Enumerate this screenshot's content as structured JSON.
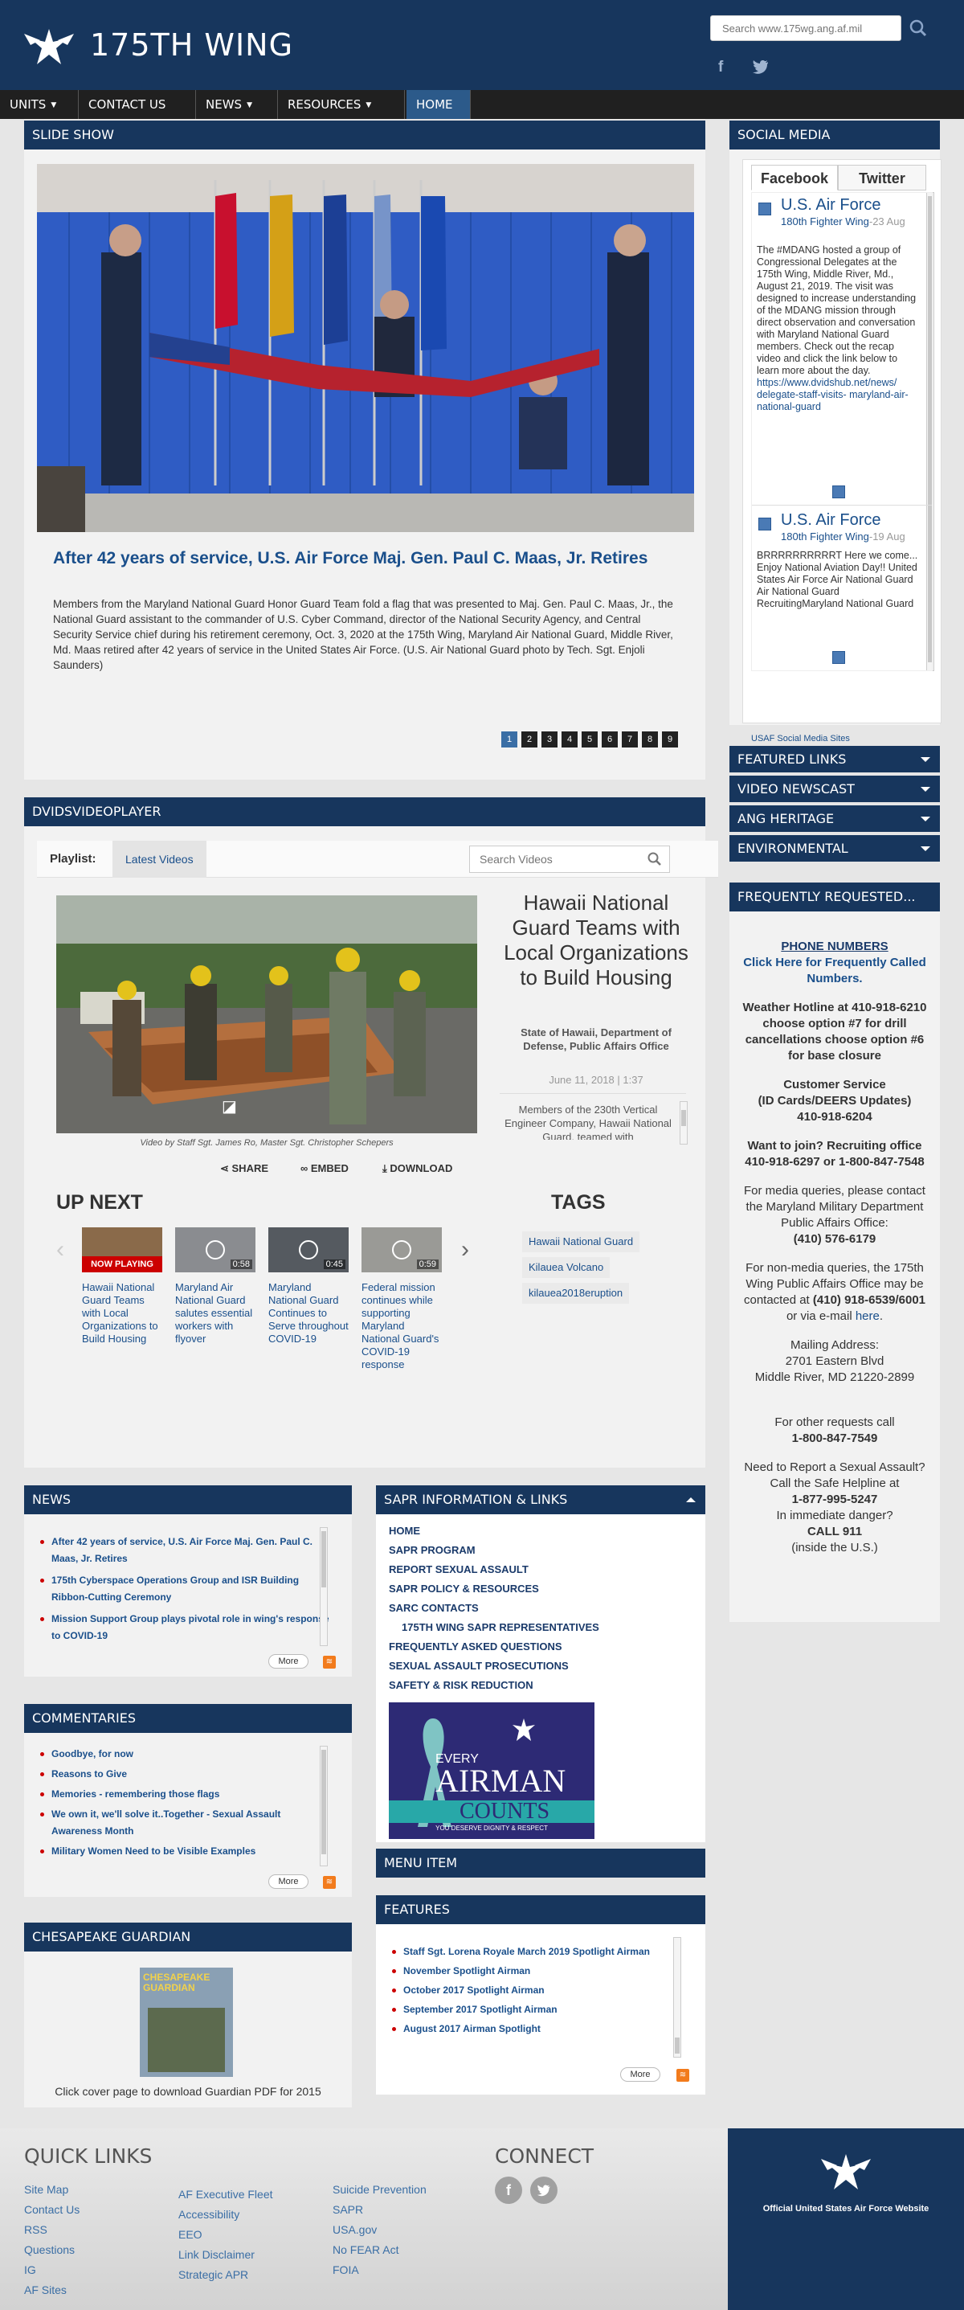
{
  "header": {
    "site_title": "175TH WING",
    "search_placeholder": "Search www.175wg.ang.af.mil",
    "facebook_glyph": "f"
  },
  "nav": {
    "items": [
      {
        "label": "UNITS"
      },
      {
        "label": "CONTACT US"
      },
      {
        "label": "NEWS"
      },
      {
        "label": "RESOURCES"
      },
      {
        "label": "HOME"
      }
    ]
  },
  "slideshow": {
    "heading": "SLIDE SHOW",
    "title": "After 42 years of service, U.S. Air Force Maj. Gen. Paul C. Maas, Jr. Retires",
    "caption": "Members from the Maryland National Guard Honor Guard Team fold a flag that was presented to Maj. Gen. Paul C. Maas, Jr., the National Guard assistant to the commander of U.S. Cyber Command, director of the National Security Agency, and Central Security Service chief during his retirement ceremony, Oct. 3, 2020 at the 175th Wing, Maryland Air National Guard, Middle River, Md. Maas retired after 42 years of service in the United States Air Force. (U.S. Air National Guard photo by Tech. Sgt. Enjoli Saunders)",
    "pages": [
      "1",
      "2",
      "3",
      "4",
      "5",
      "6",
      "7",
      "8",
      "9"
    ],
    "active_page": 1
  },
  "social": {
    "heading": "SOCIAL MEDIA",
    "tabs": [
      "Facebook",
      "Twitter"
    ],
    "posts": [
      {
        "account": "U.S. Air Force",
        "source": "180th Fighter Wing",
        "date": "23 Aug",
        "body": "The #MDANG hosted a group of Congressional Delegates at the 175th Wing, Middle River, Md., August 21, 2019. The visit was designed to increase understanding of the MDANG mission through direct observation and conversation with Maryland National Guard members. Check out the recap video and click the link below to learn more about the day.",
        "link": "https://www.dvidshub.net/news/ delegate-staff-visits- maryland-air-national-guard"
      },
      {
        "account": "U.S. Air Force",
        "source": "180th Fighter Wing",
        "date": "19 Aug",
        "body": "BRRRRRRRRRRT Here we come... Enjoy National Aviation Day!! United States Air Force Air National Guard Air National Guard RecruitingMaryland National Guard"
      }
    ],
    "footer_link": "USAF Social Media Sites"
  },
  "sidebar_collapsibles": [
    "FEATURED LINKS",
    "VIDEO NEWSCAST",
    "ANG HERITAGE",
    "ENVIRONMENTAL"
  ],
  "freq": {
    "heading": "FREQUENTLY REQUESTED...",
    "phone_heading": "PHONE NUMBERS",
    "phone_click": "Click Here for Frequently Called Numbers.",
    "weather": "Weather Hotline at 410-918-6210 choose option #7 for drill cancellations choose option #6 for base closure",
    "cs_title": "Customer Service",
    "cs_sub": "(ID Cards/DEERS Updates)",
    "cs_phone": "410-918-6204",
    "join_title": "Want to join? Recruiting office",
    "join_phone": "410-918-6297 or 1-800-847-7548",
    "media_text": "For media queries, please contact the Maryland Military Department Public Affairs Office:",
    "media_phone": "(410) 576-6179",
    "nonmedia_text": "For non-media queries, the 175th Wing Public Affairs Office may be contacted at",
    "nonmedia_phone": "(410) 918-6539/6001",
    "nonmedia_or": "or via e-mail",
    "nonmedia_here": "here",
    "mail_title": "Mailing Address:",
    "mail_line1": "2701 Eastern Blvd",
    "mail_line2": "Middle River, MD 21220-2899",
    "other_text": "For other requests call",
    "other_phone": "1-800-847-7549",
    "sexual_text": "Need to Report a Sexual Assault?",
    "safe_text": "Call the Safe Helpline at",
    "safe_phone": "1-877-995-5247",
    "danger_text": "In immediate danger?",
    "call_911": "CALL 911",
    "inside_us": "(inside the U.S.)"
  },
  "dvids": {
    "heading": "DVIDSVIDEOPLAYER",
    "playlist_label": "Playlist:",
    "playlist_value": "Latest Videos",
    "search_placeholder": "Search Videos",
    "video_title": "Hawaii National Guard Teams with Local Organizations to Build Housing",
    "video_source": "State of Hawaii, Department of Defense, Public Affairs Office",
    "video_date": "June 11, 2018 | 1:37",
    "video_desc": "Members of the 230th Vertical Engineer Company, Hawaii National Guard, teamed with",
    "video_credit": "Video by Staff Sgt. James Ro, Master Sgt. Christopher Schepers",
    "share": "SHARE",
    "embed": "EMBED",
    "download": "DOWNLOAD",
    "up_next_heading": "UP NEXT",
    "tags_heading": "TAGS",
    "up_next": [
      {
        "title": "Hawaii National Guard Teams with Local Organizations to Build Housing",
        "badge": "NOW PLAYING"
      },
      {
        "title": "Maryland Air National Guard salutes essential workers with flyover",
        "duration": "0:58"
      },
      {
        "title": "Maryland National Guard Continues to Serve throughout COVID-19",
        "duration": "0:45"
      },
      {
        "title": "Federal mission continues while supporting Maryland National Guard's COVID-19 response",
        "duration": "0:59"
      }
    ],
    "tags": [
      "Hawaii National Guard",
      "Kilauea Volcano",
      "kilauea2018eruption"
    ]
  },
  "news": {
    "heading": "NEWS",
    "items": [
      "After 42 years of service, U.S. Air Force Maj. Gen. Paul C. Maas, Jr. Retires",
      "175th Cyberspace Operations Group and ISR Building Ribbon-Cutting Ceremony",
      "Mission Support Group plays pivotal role in wing's response to COVID-19"
    ],
    "more": "More"
  },
  "commentaries": {
    "heading": "COMMENTARIES",
    "items": [
      "Goodbye, for now",
      "Reasons to Give",
      "Memories - remembering those flags",
      "We own it, we'll solve it..Together - Sexual Assault Awareness Month",
      "Military Women Need to be Visible Examples"
    ],
    "more": "More"
  },
  "chesapeake": {
    "heading": "CHESAPEAKE GUARDIAN",
    "cover_text": "CHESAPEAKE GUARDIAN",
    "caption": "Click cover page to download Guardian PDF for 2015"
  },
  "sapr": {
    "heading": "SAPR INFORMATION & LINKS",
    "links": [
      "HOME",
      "SAPR PROGRAM",
      "REPORT SEXUAL ASSAULT",
      "SAPR POLICY & RESOURCES",
      "SARC CONTACTS",
      "175TH WING SAPR REPRESENTATIVES",
      "FREQUENTLY ASKED QUESTIONS",
      "SEXUAL ASSAULT PROSECUTIONS",
      "SAFETY & RISK REDUCTION"
    ],
    "banner": {
      "line1": "EVERY",
      "line2": "AIRMAN",
      "line3": "COUNTS",
      "tagline": "YOU DESERVE DIGNITY & RESPECT"
    }
  },
  "menu_item": {
    "heading": "MENU ITEM"
  },
  "features": {
    "heading": "FEATURES",
    "items": [
      "Staff Sgt. Lorena Royale March 2019 Spotlight Airman",
      "November Spotlight Airman",
      "October 2017 Spotlight Airman",
      "September 2017 Spotlight Airman",
      "August 2017 Airman Spotlight"
    ],
    "more": "More"
  },
  "footer": {
    "quick_links_heading": "QUICK LINKS",
    "col1": [
      "Site Map",
      "Contact Us",
      "RSS",
      "Questions",
      "IG",
      "AF Sites"
    ],
    "col2": [
      "AF Executive Fleet",
      "Accessibility",
      "EEO",
      "Link Disclaimer",
      "Strategic APR"
    ],
    "col3": [
      "Suicide Prevention",
      "SAPR",
      "USA.gov",
      "No FEAR Act",
      "FOIA"
    ],
    "connect_heading": "CONNECT",
    "official": "Official United States Air Force Website"
  },
  "colors": {
    "navy": "#17365d",
    "link": "#1a4f8b",
    "nav": "#202020",
    "nav_active": "#2c5a8a",
    "alert_red": "#c00000"
  }
}
